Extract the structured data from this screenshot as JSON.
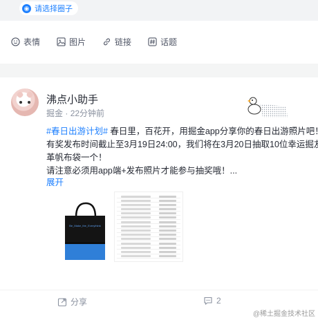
{
  "composer": {
    "circle_chip": "请选择圈子",
    "toolbar": [
      {
        "icon": "smile-icon",
        "label": "表情"
      },
      {
        "icon": "image-icon",
        "label": "图片"
      },
      {
        "icon": "link-icon",
        "label": "链接"
      },
      {
        "icon": "topic-icon",
        "label": "话题"
      }
    ]
  },
  "post": {
    "author": "沸点小助手",
    "source": "掘金",
    "dot": " · ",
    "time": "22分钟前",
    "topic_tag": "#春日出游计划#",
    "line1_rest": " 春日里，百花开，用掘金app分享你的春日出游照片吧！",
    "line2": "有奖发布时间截止至3月19日24:00，我们将在3月20日抽取10位幸运掘友赠",
    "line3": "革帆布袋一个！",
    "line4": "请注意必须用app端+发布照片才能参与抽奖哦！...",
    "expand_label": "展开",
    "bag_text": "Be_Make_the_Everythink"
  },
  "actions": {
    "share_label": "分享",
    "comment_count": "2"
  },
  "watermark": "@稀土掘金技术社区",
  "colors": {
    "accent": "#1e80ff",
    "bag_blue": "#2f7fd8"
  }
}
